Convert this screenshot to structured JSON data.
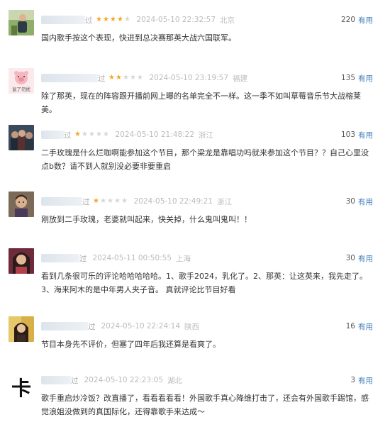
{
  "comments": [
    {
      "user_tail": "过",
      "rating": 4,
      "time": "2024-05-10 22:32:57",
      "location": "北京",
      "votes": "220",
      "useful_label": "有用",
      "text": "国内歌手按这个表现，快进到总决赛那英大战六国联军。",
      "avatar_icon": "person-photo-avatar",
      "avatar_text": ""
    },
    {
      "user_tail": "过",
      "rating": 2,
      "time": "2024-05-10 23:19:57",
      "location": "福建",
      "votes": "135",
      "useful_label": "有用",
      "text": "除了那英，现在的阵容跟开播前网上曝的名单完全不一样。这一季不如叫草莓音乐节大战榕莱美。",
      "avatar_icon": "cartoon-pig-avatar",
      "avatar_text": "鼠了勿扰"
    },
    {
      "user_tail": "过",
      "rating": 1,
      "time": "2024-05-10 21:48:22",
      "location": "浙江",
      "votes": "103",
      "useful_label": "有用",
      "text": "二手玫瑰是什么烂咖啊能参加这个节目，那个梁龙是靠唱功吗就来参加这个节目？？自己心里没点b数？请不到人就别没必要非要重启",
      "avatar_icon": "group-photo-avatar",
      "avatar_text": ""
    },
    {
      "user_tail": "过",
      "rating": 1,
      "time": "2024-05-10 22:49:21",
      "location": "浙江",
      "votes": "30",
      "useful_label": "有用",
      "text": "刚放到二手玫瑰，老婆就叫起来，快关掉，什么鬼叫鬼叫！！",
      "avatar_icon": "person-photo-avatar",
      "avatar_text": ""
    },
    {
      "user_tail": "过",
      "rating": 0,
      "time": "2024-05-11 00:50:55",
      "location": "上海",
      "votes": "30",
      "useful_label": "有用",
      "text": "看到几条很可乐的评论哈哈哈哈哈。1、歌手2024，乳化了。2、那英：让这英来，我先走了。3、海来阿木的是中年男人夹子音。 真就评论比节目好看",
      "avatar_icon": "woman-photo-avatar",
      "avatar_text": ""
    },
    {
      "user_tail": "过",
      "rating": 0,
      "time": "2024-05-10 22:24:14",
      "location": "陕西",
      "votes": "16",
      "useful_label": "有用",
      "text": "节目本身先不评价，但塞了四年后我还算是看爽了。",
      "avatar_icon": "woman-photo-avatar",
      "avatar_text": ""
    },
    {
      "user_tail": "过",
      "rating": 0,
      "time": "2024-05-10 22:23:05",
      "location": "湖北",
      "votes": "3",
      "useful_label": "有用",
      "text": "歌手重启炒冷饭？改直播了，看看看看看！外国歌手真心降维打击了，还会有外国歌手踢馆，感觉浪姐没做到的真国际化，还得靠歌手来达成～",
      "avatar_icon": "calligraphy-character-avatar",
      "avatar_text": "卡"
    }
  ],
  "colors": {
    "star_on": "#f5a623",
    "star_off": "#d6d6d6",
    "useful_link": "#3d7ab8",
    "meta_gray": "#aaaaaa"
  }
}
